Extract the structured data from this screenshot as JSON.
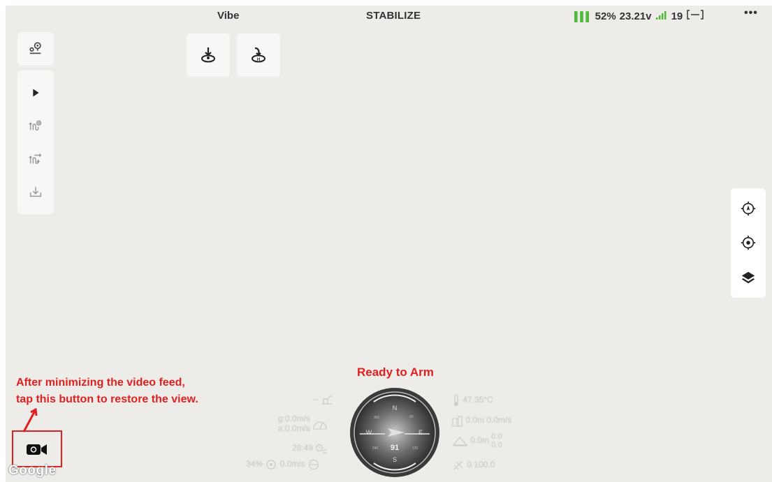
{
  "topbar": {
    "vehicle_name": "Vibe",
    "flight_mode": "STABILIZE",
    "battery_percent": "52%",
    "battery_voltage": "23.21v",
    "satellites": "19",
    "more": "•••"
  },
  "toolbar_top": {
    "icon": "waypoint-route-icon"
  },
  "toolbar_side": {
    "items": [
      {
        "icon": "play-icon"
      },
      {
        "icon": "mission-clear-icon"
      },
      {
        "icon": "mission-upload-icon"
      },
      {
        "icon": "download-icon"
      }
    ]
  },
  "actions": {
    "takeoff_icon": "takeoff-icon",
    "land_icon": "land-icon"
  },
  "right_tools": {
    "items": [
      "center-on-vehicle-icon",
      "my-location-icon",
      "map-layers-icon"
    ]
  },
  "status": {
    "arm_state": "Ready to Arm"
  },
  "annotation": {
    "line1": "After minimizing the video feed,",
    "line2": "tap this button to restore the view."
  },
  "video_restore": {
    "icon": "video-camera-icon"
  },
  "map_attribution": "Google",
  "telemetry": {
    "distance": "--",
    "ground_speed": "g:0.0m/s",
    "air_speed": "a:0.0m/s",
    "flight_time": "28:49",
    "throttle": "34%",
    "climb_rate": "0.0m/s",
    "temperature": "47.35°C",
    "altitude": "0.0m 0.0m/s",
    "terrain_alt": "0.0m",
    "terrain_top": "0.0",
    "terrain_bottom": "0.0",
    "rc": "0 100.0"
  },
  "compass": {
    "heading": "91",
    "labels": {
      "n": "N",
      "e": "E",
      "s": "S",
      "w": "W"
    },
    "minor": [
      "30",
      "60",
      "120",
      "150",
      "210",
      "240",
      "300",
      "330"
    ]
  },
  "colors": {
    "map_bg": "#eeece8",
    "alert_red": "#e02020",
    "battery_green": "#4fba3a"
  }
}
